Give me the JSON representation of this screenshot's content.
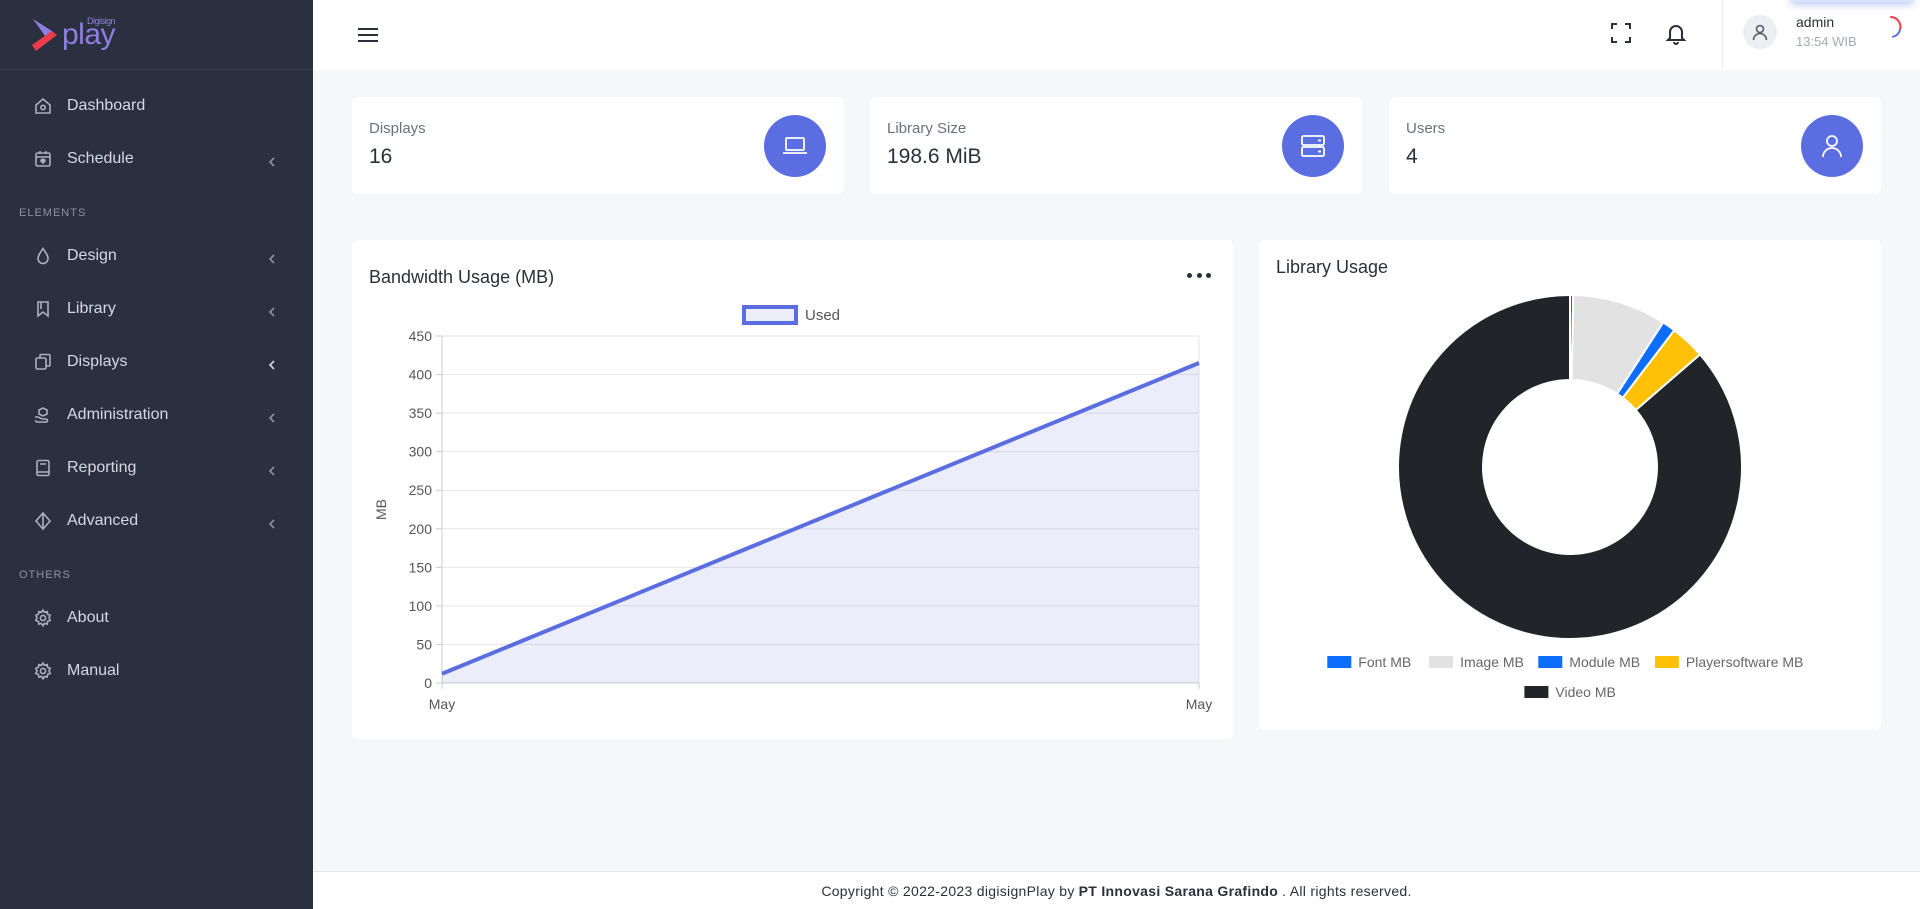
{
  "brand": {
    "name": "play",
    "sub": "Digisign"
  },
  "sidebar": {
    "items_top": [
      {
        "label": "Dashboard",
        "icon": "home-icon"
      },
      {
        "label": "Schedule",
        "icon": "calendar-icon"
      }
    ],
    "section_elements": "ELEMENTS",
    "items_elements": [
      {
        "label": "Design",
        "icon": "droplet-icon"
      },
      {
        "label": "Library",
        "icon": "bookmark-icon"
      },
      {
        "label": "Displays",
        "icon": "copy-icon"
      },
      {
        "label": "Administration",
        "icon": "hand-icon"
      },
      {
        "label": "Reporting",
        "icon": "book-icon"
      },
      {
        "label": "Advanced",
        "icon": "diamond-icon"
      }
    ],
    "section_others": "OTHERS",
    "items_others": [
      {
        "label": "About",
        "icon": "gear-icon"
      },
      {
        "label": "Manual",
        "icon": "gear-icon"
      }
    ]
  },
  "header": {
    "user_name": "admin",
    "user_time": "13:54 WIB"
  },
  "stats": [
    {
      "label": "Displays",
      "value": "16",
      "icon": "laptop-icon"
    },
    {
      "label": "Library Size",
      "value": "198.6 MiB",
      "icon": "server-icon"
    },
    {
      "label": "Users",
      "value": "4",
      "icon": "user-icon"
    }
  ],
  "bandwidth": {
    "title": "Bandwidth Usage (MB)"
  },
  "library": {
    "title": "Library Usage"
  },
  "chart_data": [
    {
      "type": "area",
      "title": "Bandwidth Usage (MB)",
      "x": [
        "May",
        "May"
      ],
      "series": [
        {
          "name": "Used",
          "values": [
            12,
            415
          ],
          "color": "#5b6ee1"
        }
      ],
      "xlabel": "",
      "ylabel": "MB",
      "ylim": [
        0,
        450
      ],
      "yticks": [
        0,
        50,
        100,
        150,
        200,
        250,
        300,
        350,
        400,
        450
      ],
      "grid": true,
      "legend": "top"
    },
    {
      "type": "pie",
      "title": "Library Usage",
      "donut": true,
      "categories": [
        "Font MB",
        "Image MB",
        "Module MB",
        "Playersoftware MB",
        "Video MB"
      ],
      "values": [
        0.6,
        17.5,
        2.5,
        6.5,
        171.5
      ],
      "colors": [
        "#0d6efd",
        "#e2e2e2",
        "#0d6efd",
        "#ffc107",
        "#212529"
      ],
      "legend": "bottom"
    }
  ],
  "footer": {
    "prefix": "Copyright © 2022-2023 digisignPlay by",
    "company": "PT Innovasi Sarana Grafindo",
    "suffix": ". All rights reserved."
  }
}
